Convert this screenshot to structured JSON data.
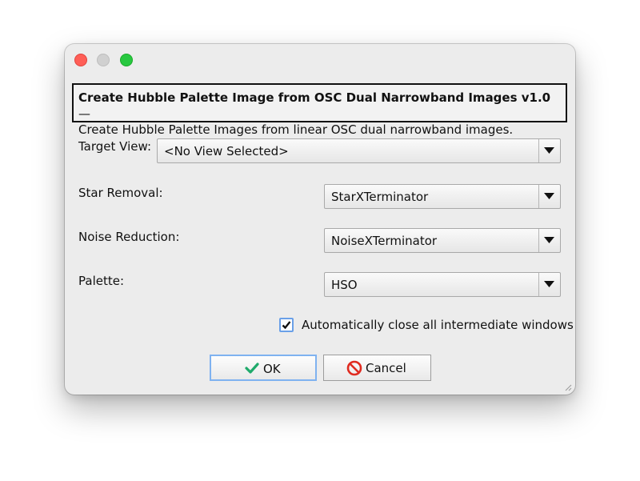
{
  "dialog": {
    "header_title": "Create Hubble Palette Image from OSC Dual Narrowband Images v1.0",
    "header_dash": " —",
    "header_description": "Create Hubble Palette Images from linear OSC dual narrowband images.",
    "target_view": {
      "label": "Target View:",
      "value": "<No View Selected>"
    },
    "star_removal": {
      "label": "Star Removal:",
      "value": "StarXTerminator"
    },
    "noise_reduction": {
      "label": "Noise Reduction:",
      "value": "NoiseXTerminator"
    },
    "palette": {
      "label": "Palette:",
      "value": "HSO"
    },
    "auto_close": {
      "label": "Automatically close all intermediate windows",
      "checked": true
    },
    "ok_label": "OK",
    "cancel_label": "Cancel"
  },
  "icons": {
    "close": "window-close-icon",
    "minimize": "window-minimize-icon",
    "zoom": "window-zoom-icon",
    "ok": "checkmark-icon",
    "cancel": "prohibited-icon",
    "dropdown": "triangle-down-icon"
  },
  "colors": {
    "ok_check": "#1faa6b",
    "cancel_icon": "#e02b20",
    "focus_ring": "#7fb2f0"
  }
}
